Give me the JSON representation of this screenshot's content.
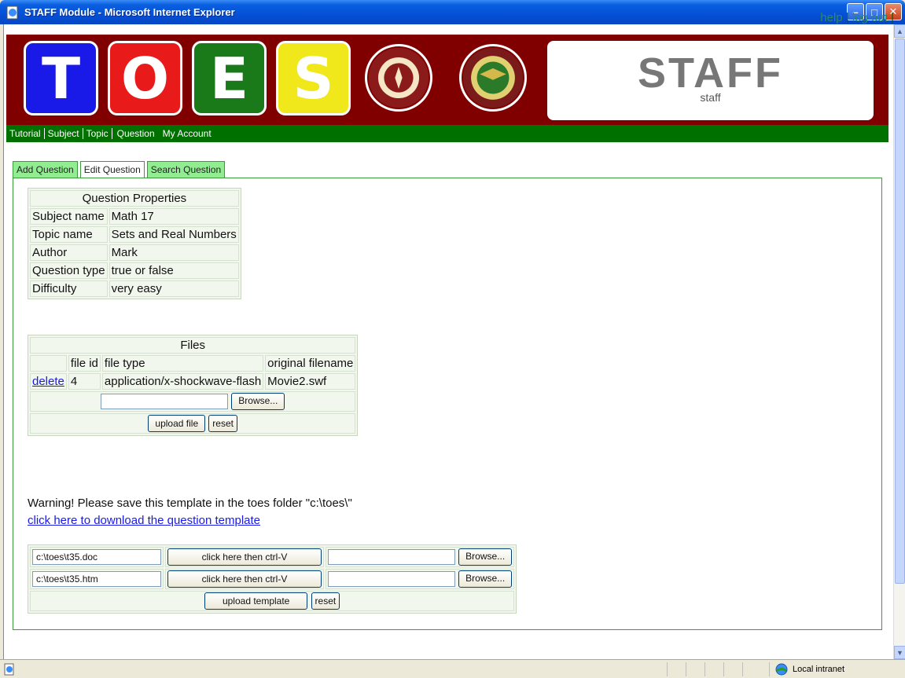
{
  "window": {
    "title": "STAFF Module - Microsoft Internet Explorer"
  },
  "toplinks": {
    "help": "help",
    "logout": "log out",
    "sep": "|"
  },
  "banner": {
    "tiles": [
      {
        "letter": "T",
        "color": "#1a1ae8"
      },
      {
        "letter": "O",
        "color": "#e81a1a"
      },
      {
        "letter": "E",
        "color": "#1a7a1a"
      },
      {
        "letter": "S",
        "color": "#f0e81a"
      }
    ],
    "staff_title": "STAFF",
    "staff_sub": "staff"
  },
  "nav": {
    "items": [
      "Tutorial",
      "Subject",
      "Topic",
      "Question",
      "My Account"
    ],
    "active": "Question"
  },
  "tabs": [
    "Add Question",
    "Edit Question",
    "Search Question"
  ],
  "properties": {
    "header": "Question Properties",
    "rows": [
      {
        "label": "Subject name",
        "value": "Math 17"
      },
      {
        "label": "Topic name",
        "value": "Sets and Real Numbers"
      },
      {
        "label": "Author",
        "value": "Mark"
      },
      {
        "label": "Question type",
        "value": "true or false"
      },
      {
        "label": "Difficulty",
        "value": "very easy"
      }
    ]
  },
  "files": {
    "header": "Files",
    "columns": [
      "file id",
      "file type",
      "original filename"
    ],
    "row": {
      "action": "delete",
      "id": "4",
      "type": "application/x-shockwave-flash",
      "filename": "Movie2.swf"
    },
    "browse": "Browse...",
    "upload": "upload file",
    "reset": "reset"
  },
  "warning": "Warning! Please save this template in the toes folder \"c:\\toes\\\"",
  "download_link": "click here to download the question template",
  "templates": {
    "rows": [
      {
        "path": "c:\\toes\\t35.doc",
        "paste": "click here then ctrl-V",
        "browse": "Browse..."
      },
      {
        "path": "c:\\toes\\t35.htm",
        "paste": "click here then ctrl-V",
        "browse": "Browse..."
      }
    ],
    "upload": "upload template",
    "reset": "reset"
  },
  "status": {
    "zone": "Local intranet"
  }
}
